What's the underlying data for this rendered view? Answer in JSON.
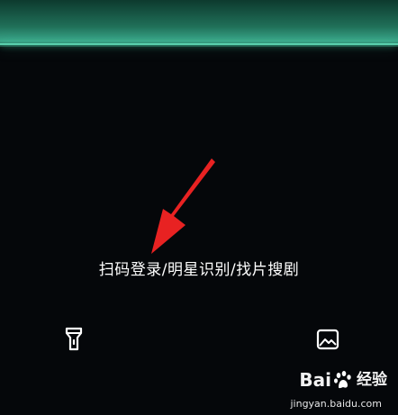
{
  "scanner": {
    "hint": "扫码登录/明星识别/找片搜剧"
  },
  "controls": {
    "flashlight_icon": "flashlight-icon",
    "gallery_icon": "image-gallery-icon"
  },
  "watermark": {
    "logo_bai": "Bai",
    "logo_du": "du",
    "logo_jingyan": "经验",
    "url": "jingyan.baidu.com"
  },
  "colors": {
    "background": "#05070a",
    "scan_accent": "#46c9a1",
    "arrow": "#e82222",
    "text": "#ffffff"
  }
}
